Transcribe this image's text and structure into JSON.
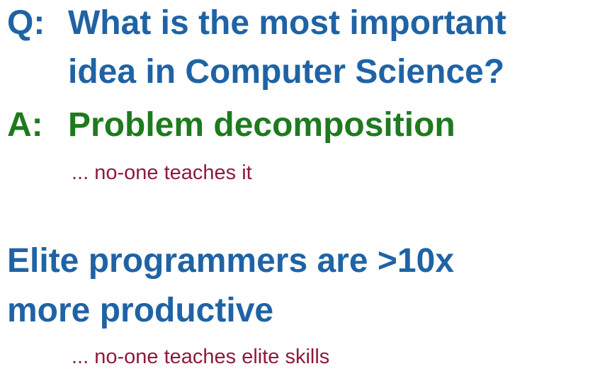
{
  "qa": {
    "question_label": "Q:",
    "question_line_1": "What is the most important",
    "question_line_2": "idea in Computer Science?",
    "answer_label": "A:",
    "answer": "Problem decomposition",
    "answer_note": "... no-one teaches it"
  },
  "elite": {
    "line_1": "Elite programmers are >10x",
    "line_2": "more productive",
    "note": "... no-one teaches elite skills"
  },
  "colors": {
    "blue_text": "#1f63a5",
    "green_text": "#1e7a1e",
    "note_text": "#8e1b3b",
    "background": "#ffffff"
  }
}
